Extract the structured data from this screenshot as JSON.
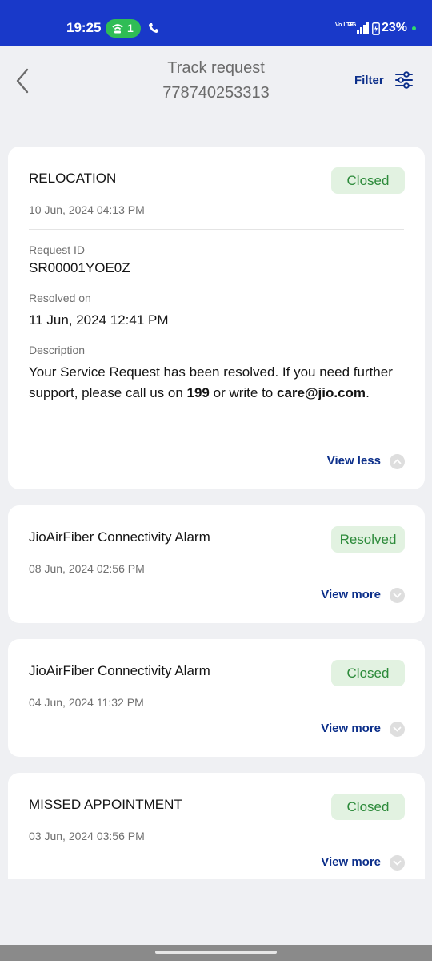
{
  "status_bar": {
    "time": "19:25",
    "hotspot_count": "1",
    "volte": "Vo LTE",
    "network": "4G",
    "battery_pct": "23%"
  },
  "header": {
    "title": "Track request",
    "subtitle": "778740253313",
    "filter_label": "Filter"
  },
  "requests": [
    {
      "title": "RELOCATION",
      "status": "Closed",
      "date": "10 Jun, 2024 04:13 PM",
      "request_id_label": "Request ID",
      "request_id": "SR00001YOE0Z",
      "resolved_label": "Resolved on",
      "resolved_on": "11 Jun, 2024 12:41 PM",
      "description_label": "Description",
      "description_prefix": "Your Service Request has been resolved. If you need further support, please call us on ",
      "description_phone": "199",
      "description_middle": " or write to ",
      "description_email": "care@jio.com",
      "description_suffix": ".",
      "toggle_label": "View less"
    },
    {
      "title": "JioAirFiber Connectivity Alarm",
      "status": "Resolved",
      "date": "08 Jun, 2024 02:56 PM",
      "toggle_label": "View more"
    },
    {
      "title": "JioAirFiber Connectivity Alarm",
      "status": "Closed",
      "date": "04 Jun, 2024 11:32 PM",
      "toggle_label": "View more"
    },
    {
      "title": "MISSED APPOINTMENT",
      "status": "Closed",
      "date": "03 Jun, 2024 03:56 PM",
      "toggle_label": "View more"
    }
  ],
  "colors": {
    "status_bar_bg": "#1939c9",
    "accent_text": "#0c2f8a",
    "badge_bg": "#e2f2e1",
    "badge_text": "#2c8a3a",
    "page_bg": "#eff0f3"
  },
  "icons": {
    "back": "chevron-left-icon",
    "filter": "sliders-icon",
    "expand": "chevron-down-icon",
    "collapse": "chevron-up-icon"
  }
}
